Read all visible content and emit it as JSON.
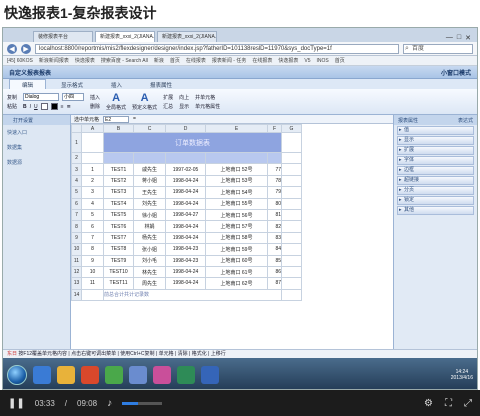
{
  "page_title": "快逸报表1-复杂报表设计",
  "browser": {
    "tabs": [
      "装修报表平台",
      "新建报表_xxxi_2(JIANA...",
      "新建报表_xxxi_2(JIANA..."
    ],
    "url": "localhost:8800/reportmis/mis2/flexdesigner/designer/index.jsp?fatherID=101138reslD=11970&sys_docType=1f",
    "search_placeholder": "百度",
    "favorites": [
      "[45] 60KOS",
      "新浪新闻报表",
      "快逸报表",
      "搜索百度 - Search All",
      "新浪",
      "首页",
      "在线报表",
      "报表新闻 - 任务",
      "在线报表",
      "快逸报表",
      "V5",
      "INOS",
      "首页"
    ]
  },
  "app": {
    "title": "自定义报表报表",
    "right_title": "小窗口模式",
    "ribbon_tabs": [
      "编辑",
      "显示格式",
      "插入",
      "报表属性"
    ],
    "ribbon": {
      "copy": "复制",
      "paste": "粘贴",
      "font": "Dialog",
      "size": "小四",
      "bold": "B",
      "italic": "I",
      "underline": "U",
      "insert": "插入",
      "delete": "删除",
      "all_format": "全局格式",
      "preset_format": "预定义格式",
      "expand": "扩展",
      "sum": "汇总",
      "up": "向上",
      "show": "显示",
      "merge": "并单元格",
      "cell_attr": "单元格属性"
    }
  },
  "left_pane": {
    "header": "打开设置",
    "items": [
      "快速入口",
      "数据集",
      "数据源"
    ]
  },
  "formula": {
    "label": "选中单元格",
    "ref": "E2",
    "value": "="
  },
  "sheet": {
    "columns": [
      "A",
      "B",
      "C",
      "D",
      "E",
      "F",
      "G"
    ],
    "title": "订单数据表",
    "rows": [
      [
        "1",
        "TEST1",
        "戚先生",
        "1997-02-05",
        "上地南口 52号",
        "77"
      ],
      [
        "2",
        "TEST2",
        "蒋小姐",
        "1998-04-24",
        "上地南口 53号",
        "78"
      ],
      [
        "3",
        "TEST3",
        "王先生",
        "1998-04-24",
        "上地南口 54号",
        "79"
      ],
      [
        "4",
        "TEST4",
        "刘先生",
        "1998-04-24",
        "上地南口 55号",
        "80"
      ],
      [
        "5",
        "TEST5",
        "徐小姐",
        "1998-04-27",
        "上地南口 56号",
        "81"
      ],
      [
        "6",
        "TEST6",
        "林娟",
        "1998-04-24",
        "上地南口 57号",
        "82"
      ],
      [
        "7",
        "TEST7",
        "杨先生",
        "1998-04-24",
        "上地南口 58号",
        "83"
      ],
      [
        "8",
        "TEST8",
        "张小姐",
        "1998-04-23",
        "上地南口 59号",
        "84"
      ],
      [
        "9",
        "TEST9",
        "刘小毛",
        "1998-04-23",
        "上地南口 60号",
        "85"
      ],
      [
        "10",
        "TEST10",
        "林先生",
        "1998-04-24",
        "上地南口 61号",
        "86"
      ],
      [
        "11",
        "TEST11",
        "周先生",
        "1998-04-24",
        "上地南口 62号",
        "87"
      ]
    ],
    "footer": "前总合计共计记录数"
  },
  "right_pane": {
    "tab_left": "报表属性",
    "tab_right": "表达式",
    "items": [
      "值",
      "显示",
      "扩展",
      "字体",
      "边框",
      "超链接",
      "分页",
      "锁定",
      "其他"
    ]
  },
  "status": {
    "prefix": "东日",
    "text": "按F12覆盖单元格内容 | 点击右键可调出菜单 | 使用Ctrl+C复制 | 单元格 | 清除 | 格式化 | 上移行"
  },
  "taskbar": {
    "time": "14:24",
    "date": "2013/4/16"
  },
  "player": {
    "current": "03:33",
    "total": "09:08",
    "progress": 0.39
  },
  "colors": {
    "title_band": "#8ea4e0",
    "header_band": "#b8c8ef",
    "accent": "#2f7de1"
  }
}
